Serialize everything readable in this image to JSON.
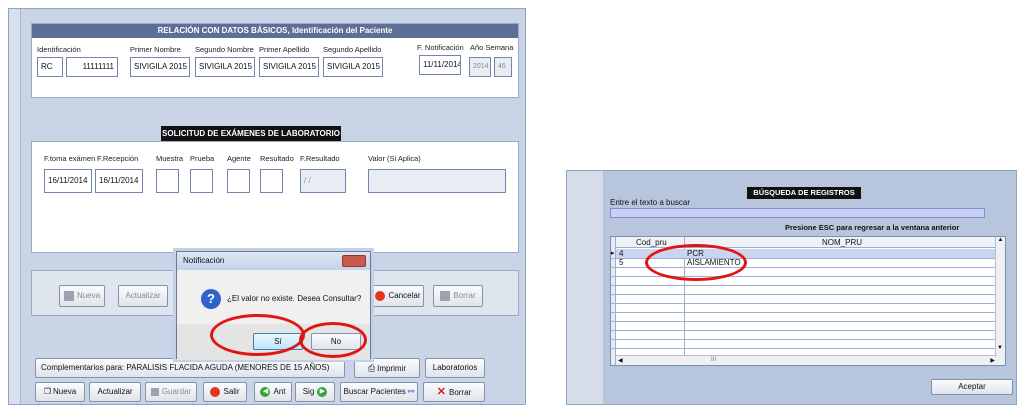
{
  "patient": {
    "title": "RELACIÓN CON DATOS BÁSICOS, Identificación del Paciente",
    "labels": {
      "identificacion": "Identificación",
      "primer_nombre": "Primer Nombre",
      "segundo_nombre": "Segundo Nombre",
      "primer_apellido": "Primer Apellido",
      "segundo_apellido": "Segundo Apellido",
      "f_notificacion": "F. Notificación",
      "anio_semana": "Año Semana"
    },
    "values": {
      "tipo_id": "RC",
      "numero_id": "11111111",
      "primer_nombre": "SIVIGILA 2015",
      "segundo_nombre": "SIVIGILA 2015",
      "primer_apellido": "SIVIGILA 2015",
      "segundo_apellido": "SIVIGILA 2015",
      "f_notificacion": "11/11/2014",
      "anio": "2014",
      "semana": "46"
    }
  },
  "lab": {
    "title": "SOLICITUD DE EXÁMENES DE LABORATORIO",
    "labels": {
      "f_toma": "F.toma exámen",
      "f_recepcion": "F.Recepción",
      "muestra": "Muestra",
      "prueba": "Prueba",
      "agente": "Agente",
      "resultado": "Resultado",
      "f_resultado": "F.Resultado",
      "valor": "Valor (Si Aplica)"
    },
    "values": {
      "f_toma": "16/11/2014",
      "f_recepcion": "16/11/2014",
      "f_resultado": "/ /"
    }
  },
  "lab_buttons": {
    "nueva": "Nueva",
    "actualizar": "Actualizar",
    "cancelar": "Cancelar",
    "borrar": "Borrar"
  },
  "dialog": {
    "title": "Notificación",
    "message": "¿El valor no existe. Desea Consultar?",
    "yes": "Sí",
    "no": "No"
  },
  "bottom_bar": {
    "complementarios": "Complementarios para: PARALISIS FLACIDA AGUDA (MENORES DE 15 AÑOS)",
    "imprimir": "Imprimir",
    "laboratorios": "Laboratorios",
    "nueva": "Nueva",
    "actualizar": "Actualizar",
    "guardar": "Guardar",
    "salir": "Salir",
    "ant": "Ant",
    "sig": "Sig",
    "buscar": "Buscar Pacientes",
    "borrar": "Borrar"
  },
  "search": {
    "title": "BÚSQUEDA DE REGISTROS",
    "prompt": "Entre el texto a buscar",
    "hint": "Presione ESC para regresar a la ventana anterior",
    "columns": [
      "Cod_pru",
      "NOM_PRU"
    ],
    "rows": [
      {
        "cod": "4",
        "nom": "PCR"
      },
      {
        "cod": "5",
        "nom": "AISLAMIENTO"
      }
    ],
    "aceptar": "Aceptar",
    "scroll_mark": "III"
  },
  "colors": {
    "title_bar": "#5d6f96",
    "accent_red": "#e21515",
    "window_bg": "#c9d4e6"
  }
}
